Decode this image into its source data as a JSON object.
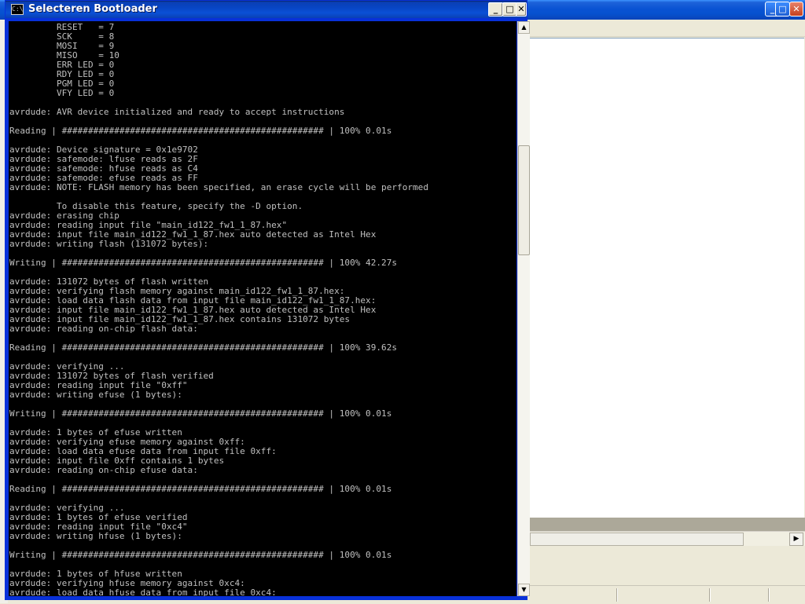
{
  "console": {
    "title": "Selecteren Bootloader",
    "icon": "console-icon",
    "icon_glyph": "C:\\",
    "buttons": {
      "minimize_glyph": "_",
      "maximize_glyph": "□",
      "close_glyph": "✕"
    },
    "lines": [
      "         RESET   = 7",
      "         SCK     = 8",
      "         MOSI    = 9",
      "         MISO    = 10",
      "         ERR LED = 0",
      "         RDY LED = 0",
      "         PGM LED = 0",
      "         VFY LED = 0",
      "",
      "avrdude: AVR device initialized and ready to accept instructions",
      "",
      "Reading | ################################################## | 100% 0.01s",
      "",
      "avrdude: Device signature = 0x1e9702",
      "avrdude: safemode: lfuse reads as 2F",
      "avrdude: safemode: hfuse reads as C4",
      "avrdude: safemode: efuse reads as FF",
      "avrdude: NOTE: FLASH memory has been specified, an erase cycle will be performed",
      "",
      "         To disable this feature, specify the -D option.",
      "avrdude: erasing chip",
      "avrdude: reading input file \"main_id122_fw1_1_87.hex\"",
      "avrdude: input file main_id122_fw1_1_87.hex auto detected as Intel Hex",
      "avrdude: writing flash (131072 bytes):",
      "",
      "Writing | ################################################## | 100% 42.27s",
      "",
      "avrdude: 131072 bytes of flash written",
      "avrdude: verifying flash memory against main_id122_fw1_1_87.hex:",
      "avrdude: load data flash data from input file main_id122_fw1_1_87.hex:",
      "avrdude: input file main_id122_fw1_1_87.hex auto detected as Intel Hex",
      "avrdude: input file main_id122_fw1_1_87.hex contains 131072 bytes",
      "avrdude: reading on-chip flash data:",
      "",
      "Reading | ################################################## | 100% 39.62s",
      "",
      "avrdude: verifying ...",
      "avrdude: 131072 bytes of flash verified",
      "avrdude: reading input file \"0xff\"",
      "avrdude: writing efuse (1 bytes):",
      "",
      "Writing | ################################################## | 100% 0.01s",
      "",
      "avrdude: 1 bytes of efuse written",
      "avrdude: verifying efuse memory against 0xff:",
      "avrdude: load data efuse data from input file 0xff:",
      "avrdude: input file 0xff contains 1 bytes",
      "avrdude: reading on-chip efuse data:",
      "",
      "Reading | ################################################## | 100% 0.01s",
      "",
      "avrdude: verifying ...",
      "avrdude: 1 bytes of efuse verified",
      "avrdude: reading input file \"0xc4\"",
      "avrdude: writing hfuse (1 bytes):",
      "",
      "Writing | ################################################## | 100% 0.01s",
      "",
      "avrdude: 1 bytes of hfuse written",
      "avrdude: verifying hfuse memory against 0xc4:",
      "avrdude: load data hfuse data from input file 0xc4:"
    ],
    "scrollbar": {
      "up_glyph": "▲",
      "down_glyph": "▼"
    }
  },
  "background_window": {
    "buttons": {
      "minimize_glyph": "_",
      "maximize_glyph": "□",
      "close_glyph": "✕"
    },
    "hscroll_right_glyph": "▶"
  },
  "colors": {
    "console_bg": "#000000",
    "console_text": "#c0c0c0",
    "titlebar_blue": "#0a50d6"
  }
}
